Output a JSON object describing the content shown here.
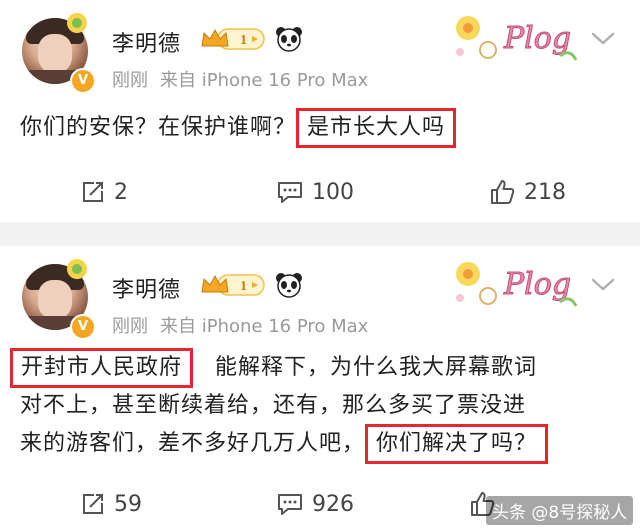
{
  "posts": [
    {
      "username": "李明德",
      "vip_level": "1",
      "avatar_badge": "V",
      "meta_time": "刚刚",
      "meta_source": "来自 iPhone 16 Pro Max",
      "sticker_text": "Plog",
      "text_plain": "你们的安保？在保护谁啊？",
      "text_highlight": "是市长大人吗",
      "actions": {
        "repost": "2",
        "comment": "100",
        "like": "218"
      }
    },
    {
      "username": "李明德",
      "vip_level": "1",
      "avatar_badge": "V",
      "meta_time": "刚刚",
      "meta_source": "来自 iPhone 16 Pro Max",
      "sticker_text": "Plog",
      "highlight_1": "开封市人民政府",
      "line1_rest": "能解释下，为什么我大屏幕歌词",
      "line2": "对不上，甚至断续着给，还有，那么多买了票没进",
      "line3_plain": "来的游客们，差不多好几万人吧，",
      "highlight_2": "你们解决了吗？",
      "actions": {
        "repost": "59",
        "comment": "926",
        "like": ""
      }
    }
  ],
  "watermark": "头条 @8号探秘人",
  "colors": {
    "highlight_border": "#e8242f",
    "meta_gray": "#9a9a9a",
    "vip_gold": "#f5a623",
    "separator": "#f2f2f2"
  },
  "icons": {
    "repost": "repost-icon",
    "comment": "comment-icon",
    "like": "like-icon",
    "more": "chevron-down-icon",
    "panda": "panda-icon",
    "crown": "crown-icon"
  }
}
